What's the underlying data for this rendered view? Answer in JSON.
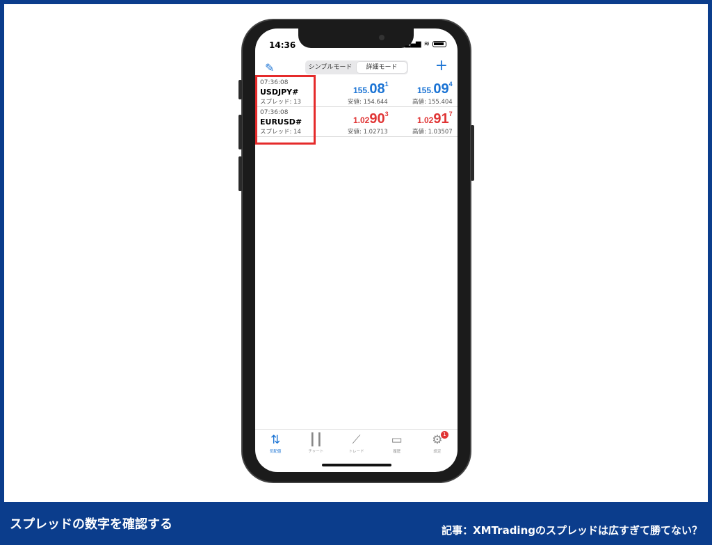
{
  "status": {
    "time": "14:36",
    "signal": "▂▄▆",
    "wifi": "≋"
  },
  "toolbar": {
    "seg_simple": "シンプルモード",
    "seg_detail": "詳細モード"
  },
  "quotes": [
    {
      "time": "07:36:08",
      "symbol": "USDJPY#",
      "spread": "スプレッド: 13",
      "bid": {
        "small": "155.",
        "big": "08",
        "tiny": "1",
        "low_label": "安値: 154.644"
      },
      "ask": {
        "small": "155.",
        "big": "09",
        "tiny": "4",
        "high_label": "高値: 155.404"
      },
      "color": "#1a73d4"
    },
    {
      "time": "07:36:08",
      "symbol": "EURUSD#",
      "spread": "スプレッド: 14",
      "bid": {
        "small": "1.02",
        "big": "90",
        "tiny": "3",
        "low_label": "安値: 1.02713"
      },
      "ask": {
        "small": "1.02",
        "big": "91",
        "tiny": "7",
        "high_label": "高値: 1.03507"
      },
      "color": "#e03434"
    }
  ],
  "tabs": [
    {
      "label": "気配値",
      "icon": "quotes-icon"
    },
    {
      "label": "チャート",
      "icon": "chart-icon"
    },
    {
      "label": "トレード",
      "icon": "trade-icon"
    },
    {
      "label": "履歴",
      "icon": "history-icon"
    },
    {
      "label": "設定",
      "icon": "settings-icon",
      "badge": "1"
    }
  ],
  "footer": {
    "caption": "スプレッドの数字を確認する",
    "article": "記事：XMTradingのスプレッドは広すぎて勝てない？"
  },
  "colors": {
    "brand": "#0b3d8c",
    "highlight": "#e52b2b",
    "bid_up": "#1a73d4",
    "bid_down": "#e03434"
  }
}
